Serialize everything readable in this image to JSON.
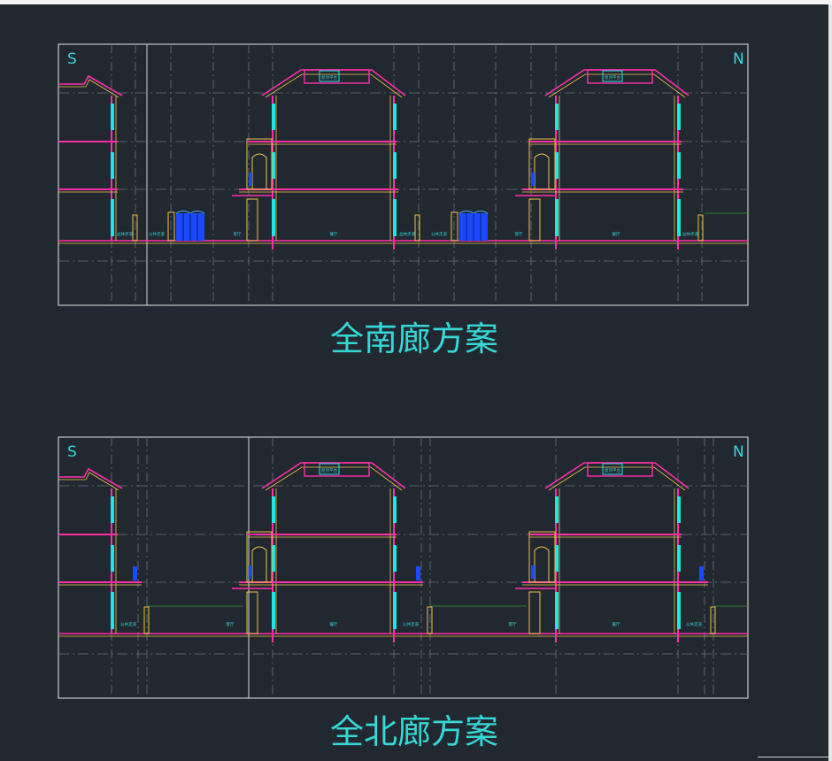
{
  "drawings": [
    {
      "title": "全南廊方案",
      "south_label": "S",
      "north_label": "N",
      "room_labels": [
        "屋顶平台",
        "屋顶平台"
      ],
      "ground_labels": [
        "丛林步道",
        "公共走道",
        "客厅",
        "餐厅",
        "丛林步道",
        "公共走道",
        "客厅",
        "餐厅",
        "丛林步道"
      ]
    },
    {
      "title": "全北廊方案",
      "south_label": "S",
      "north_label": "N",
      "room_labels": [
        "屋顶平台",
        "屋顶平台"
      ],
      "ground_labels": [
        "公共走道",
        "客厅",
        "餐厅",
        "公共走道",
        "客厅",
        "餐厅",
        "公共走道"
      ]
    }
  ],
  "colors": {
    "background": "#212830",
    "frame": "#e8e8e8",
    "wall": "#ff2fa8",
    "slab": "#ff2fa8",
    "window": "#22e4e4",
    "trim": "#f0c24a",
    "gate": "#1a49ff",
    "grid": "#6c737b",
    "text": "#36d7d7"
  }
}
